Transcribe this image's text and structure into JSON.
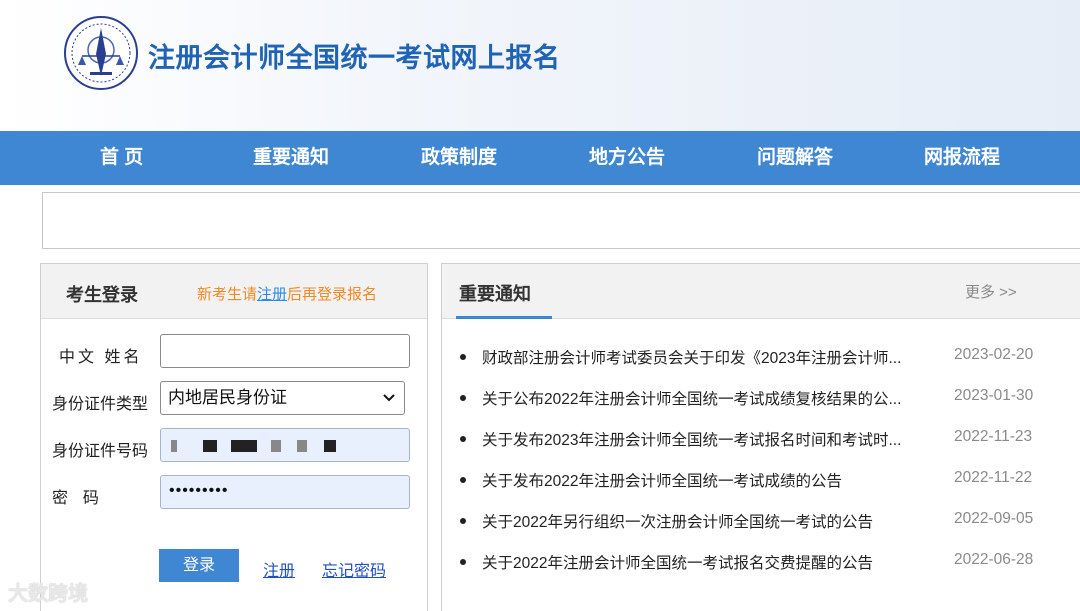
{
  "header": {
    "site_title": "注册会计师全国统一考试网上报名",
    "logo_icon": "cicpa-emblem-icon"
  },
  "nav": {
    "items": [
      {
        "label": "首 页"
      },
      {
        "label": "重要通知"
      },
      {
        "label": "政策制度"
      },
      {
        "label": "地方公告"
      },
      {
        "label": "问题解答"
      },
      {
        "label": "网报流程"
      }
    ]
  },
  "login": {
    "title": "考生登录",
    "hint_prefix": "新考生请",
    "hint_link": "注册",
    "hint_suffix": "后再登录报名",
    "name_label": "中文 姓名",
    "name_value": "",
    "id_type_label": "身份证件类型",
    "id_type_value": "内地居民身份证",
    "id_number_label": "身份证件号码",
    "password_label": "密  码",
    "password_value": "•••••••••",
    "login_button": "登录",
    "register_link": "注册",
    "forgot_link": "忘记密码"
  },
  "notices": {
    "title": "重要通知",
    "more": "更多 >>",
    "items": [
      {
        "text": "财政部注册会计师考试委员会关于印发《2023年注册会计师...",
        "date": "2023-02-20"
      },
      {
        "text": "关于公布2022年注册会计师全国统一考试成绩复核结果的公...",
        "date": "2023-01-30"
      },
      {
        "text": "关于发布2023年注册会计师全国统一考试报名时间和考试时...",
        "date": "2022-11-23"
      },
      {
        "text": "关于发布2022年注册会计师全国统一考试成绩的公告",
        "date": "2022-11-22"
      },
      {
        "text": "关于2022年另行组织一次注册会计师全国统一考试的公告",
        "date": "2022-09-05"
      },
      {
        "text": "关于2022年注册会计师全国统一考试报名交费提醒的公告",
        "date": "2022-06-28"
      }
    ]
  },
  "watermark": {
    "text": "大数跨境"
  },
  "colors": {
    "nav_bg": "#3f86d3",
    "title": "#1f64b4",
    "hint": "#f08a24"
  }
}
